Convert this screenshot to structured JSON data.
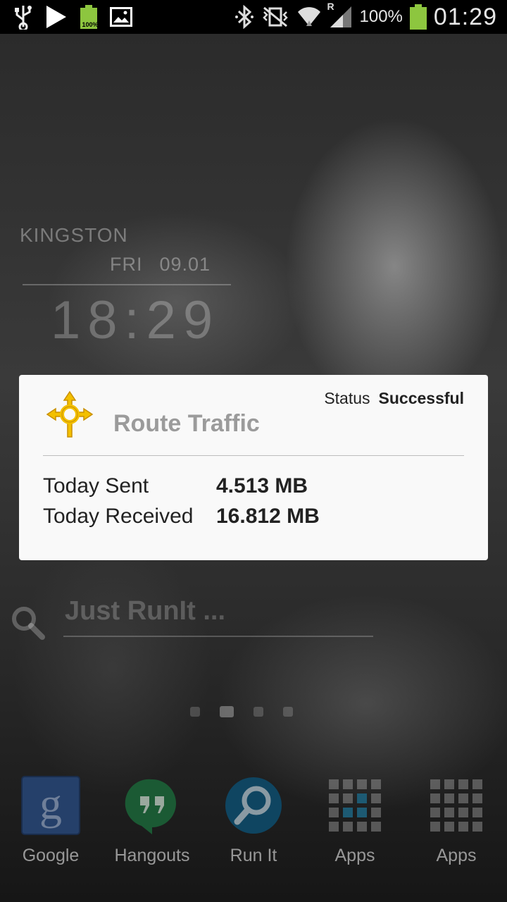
{
  "status_bar": {
    "icons_left": [
      "usb-icon",
      "play-store-icon",
      "battery-full-100-icon",
      "picture-icon"
    ],
    "battery_small_label": "100%",
    "icons_right": [
      "bluetooth-icon",
      "vibrate-mute-icon",
      "wifi-icon",
      "signal-roaming-icon",
      "battery-icon"
    ],
    "roaming_label": "R",
    "battery_percent": "100%",
    "time": "01:29"
  },
  "clock_widget": {
    "location": "KINGSTON",
    "day": "FRI",
    "date": "09.01",
    "time": "18:29"
  },
  "route_traffic": {
    "title": "Route Traffic",
    "status_label": "Status",
    "status_value": "Successful",
    "sent_label": "Today Sent",
    "sent_value": "4.513 MB",
    "received_label": "Today Received",
    "received_value": "16.812 MB",
    "accent": "#f3c000"
  },
  "search_widget": {
    "placeholder": "Just RunIt ..."
  },
  "page_indicator": {
    "count": 4,
    "active_index": 1
  },
  "dock": {
    "apps": [
      {
        "label": "Google",
        "icon": "google-icon"
      },
      {
        "label": "Hangouts",
        "icon": "hangouts-icon"
      },
      {
        "label": "Run It",
        "icon": "run-it-icon"
      },
      {
        "label": "Apps",
        "icon": "apps-grid-icon"
      },
      {
        "label": "Apps",
        "icon": "apps-grid-icon"
      }
    ]
  }
}
